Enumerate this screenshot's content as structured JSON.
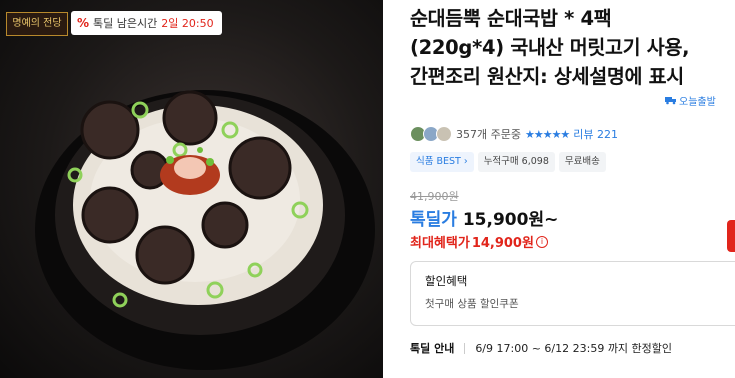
{
  "image": {
    "brand_badge": "명예의 전당",
    "timer_label": "톡딜 남은시간",
    "timer_value": "2일 20:50",
    "timer_icon": "percent-icon"
  },
  "product": {
    "title": "순대듬뿍 순대국밥 * 4팩 (220g*4) 국내산 머릿고기 사용, 간편조리 원산지: 상세설명에 표시",
    "delivery_badge": "오늘출발",
    "order_count": "357개 주문중",
    "stars": "★★★★★",
    "review_link": "리뷰 221",
    "chips": [
      "식품 BEST",
      "누적구매 6,098",
      "무료배송"
    ],
    "original_price": "41,900원",
    "deal_label": "톡딜가",
    "deal_price": "15,900원~",
    "max_benefit_label": "최대혜택가",
    "max_benefit_price": "14,900원",
    "benefit_title": "할인혜택",
    "benefit_desc": "첫구매 상품 할인쿠폰",
    "deal_info_label": "톡딜 안내",
    "deal_info_text": "6/9 17:00 ~ 6/12 23:59 까지 한정할인"
  },
  "colors": {
    "accent": "#2a7de1",
    "sale": "#e1251b"
  }
}
